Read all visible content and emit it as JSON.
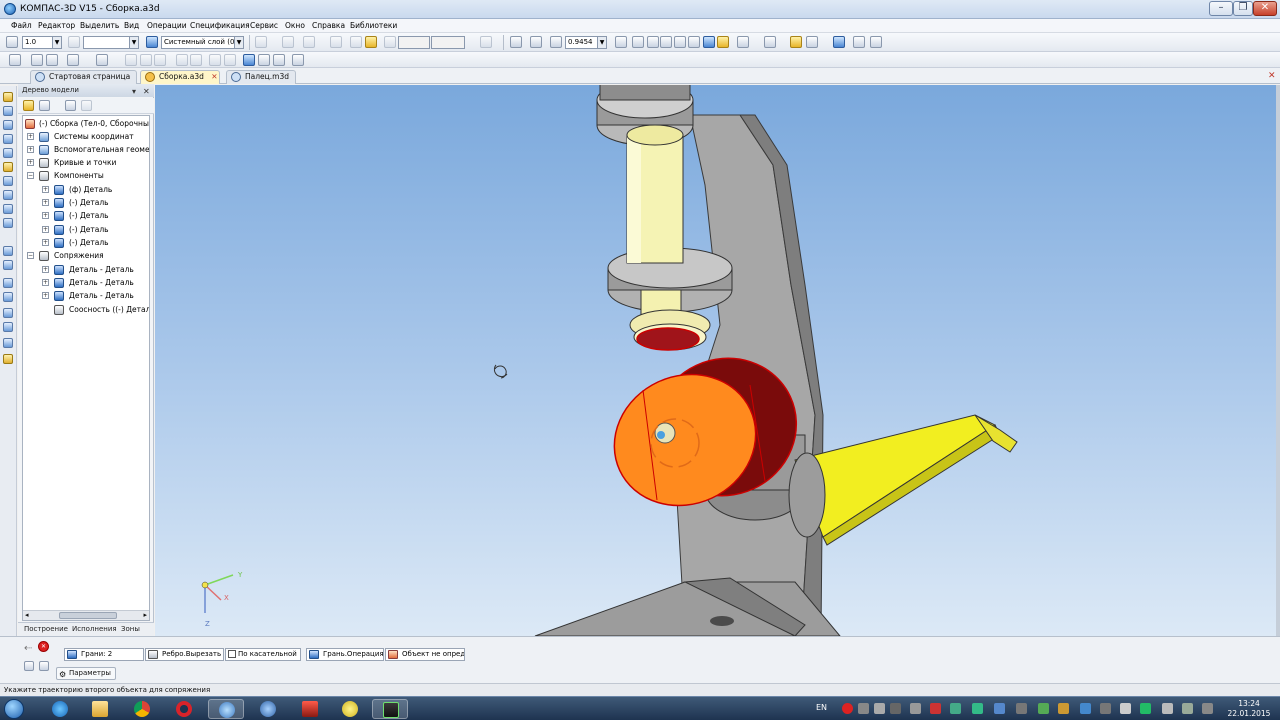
{
  "window": {
    "title": "КОМПАС-3D V15 - Сборка.a3d",
    "controls": [
      "–",
      "❐",
      "✕"
    ]
  },
  "menu": [
    "Файл",
    "Редактор",
    "Выделить",
    "Вид",
    "Операции",
    "Спецификация",
    "Сервис",
    "Окно",
    "Справка",
    "Библиотеки"
  ],
  "toolbar": {
    "step_value": "1.0",
    "layer_value": "Системный слой (0)",
    "zoom_value": "0.9454"
  },
  "tabs": [
    {
      "label": "Стартовая страница",
      "active": false
    },
    {
      "label": "Сборка.a3d",
      "active": true
    },
    {
      "label": "Палец.m3d",
      "active": false
    }
  ],
  "tree_panel": {
    "title": "Дерево модели",
    "bottom_tabs": [
      "Построение",
      "Исполнения",
      "Зоны"
    ],
    "items": [
      {
        "label": "(-) Сборка (Тел-0, Сборочны",
        "icon": "assembly-icon"
      },
      {
        "label": "Системы координат",
        "icon": "coordinate-systems-icon"
      },
      {
        "label": "Вспомогательная геомет",
        "icon": "auxiliary-geometry-icon"
      },
      {
        "label": "Кривые и точки",
        "icon": "curves-points-icon"
      },
      {
        "label": "Компоненты",
        "icon": "components-icon"
      },
      {
        "label": "(ф) Деталь",
        "icon": "part-icon"
      },
      {
        "label": "(-) Деталь",
        "icon": "part-icon"
      },
      {
        "label": "(-) Деталь",
        "icon": "part-icon"
      },
      {
        "label": "(-) Деталь",
        "icon": "part-icon"
      },
      {
        "label": "(-) Деталь",
        "icon": "part-icon"
      },
      {
        "label": "Сопряжения",
        "icon": "mates-icon"
      },
      {
        "label": "Деталь - Деталь",
        "icon": "mate-icon"
      },
      {
        "label": "Деталь - Деталь",
        "icon": "mate-icon"
      },
      {
        "label": "Деталь - Деталь",
        "icon": "mate-icon"
      },
      {
        "label": "Соосность ((-) Детал",
        "icon": "concentric-icon"
      }
    ]
  },
  "viewport": {
    "axis_labels": {
      "x": "X",
      "y": "Y",
      "z": "Z"
    }
  },
  "property_bar": {
    "faces": "Грани: 2",
    "edge": "Ребро.Вырезать э",
    "tangent": "По касательной",
    "face_op": "Грань.Операция в",
    "object": "Объект не опред",
    "params_tab": "Параметры"
  },
  "status": {
    "text": "Укажите траекторию второго объекта для сопряжения"
  },
  "taskbar": {
    "lang": "EN",
    "time": "13:24",
    "date": "22.01.2015"
  },
  "colors": {
    "sky_top": "#7aa8dc",
    "sky_bottom": "#dce9f6",
    "part_orange": "#ff8a1e",
    "part_yellow": "#f7f33a",
    "part_gray": "#9c9c9c",
    "highlight_red": "#cc0000"
  }
}
